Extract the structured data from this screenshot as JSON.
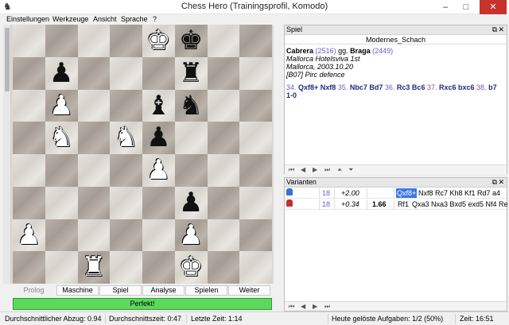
{
  "window": {
    "title": "Chess Hero (Trainingsprofil, Komodo)",
    "minimize": "–",
    "maximize": "□",
    "close": "✕"
  },
  "menu": [
    "Einstellungen",
    "Werkzeuge",
    "Ansicht",
    "Sprache",
    "?"
  ],
  "board": {
    "rows": [
      [
        "",
        "",
        "",
        "",
        "wK",
        "bK",
        "",
        ""
      ],
      [
        "",
        "bP",
        "",
        "",
        "",
        "bR",
        "",
        ""
      ],
      [
        "",
        "wP",
        "",
        "",
        "bB",
        "bN",
        "",
        ""
      ],
      [
        "",
        "wN",
        "",
        "wN",
        "bP",
        "",
        "",
        ""
      ],
      [
        "",
        "",
        "",
        "",
        "wP",
        "",
        "",
        ""
      ],
      [
        "",
        "",
        "",
        "",
        "",
        "bP",
        "",
        ""
      ],
      [
        "wP",
        "",
        "",
        "",
        "",
        "wP",
        "",
        ""
      ],
      [
        "",
        "",
        "wR",
        "",
        "",
        "wK",
        "",
        ""
      ]
    ],
    "glyphs": {
      "K": "♚",
      "Q": "♛",
      "R": "♜",
      "B": "♝",
      "N": "♞",
      "P": "♟"
    }
  },
  "tabs": [
    "Prolog",
    "Maschine",
    "Spiel",
    "Analyse",
    "Spielen",
    "Weiter"
  ],
  "feedback": "Perfekt!",
  "game_panel": {
    "title": "Spiel",
    "name": "Modernes_Schach",
    "white": "Cabrera",
    "white_elo": "(2516)",
    "vs": "gg.",
    "black": "Braga",
    "black_elo": "(2449)",
    "event": "Mallorca Hotelsviva 1st",
    "place_date": "Mallorca, 2003.10.20",
    "eco": "[B07] Pirc defence",
    "moves": [
      {
        "num": "34.",
        "text": "Qxf8+ Nxf8"
      },
      {
        "num": "35.",
        "text": "Nbc7 Bd7"
      },
      {
        "num": "36.",
        "text": "Rc3 Bc6"
      },
      {
        "num": "37.",
        "text": "Rxc6 bxc6"
      },
      {
        "num": "38.",
        "text": "b7"
      }
    ],
    "result": "1-0"
  },
  "variants_panel": {
    "title": "Varianten",
    "rows": [
      {
        "depth": "18",
        "eval": "+2.00",
        "extra": "",
        "first": "Qxf8+",
        "line": "Nxf8 Rc7 Kh8 Kf1 Rd7 a4"
      },
      {
        "depth": "18",
        "eval": "+0.34",
        "extra": "1.66",
        "first": "Rf1",
        "line": "Qxa3 Nxa3 Bxd5 exd5 Nf4 Re"
      }
    ]
  },
  "status": {
    "avg_dev": "Durchschnittlicher Abzug: 0.94",
    "avg_time": "Durchschnittszeit: 0:47",
    "last_time": "Letzte Zeit: 1:14",
    "solved": "Heute gelöste Aufgaben: 1/2 (50%)",
    "time": "Zeit: 16:51"
  },
  "colors": {
    "accent": "#3b78e7",
    "success": "#5cd85c",
    "close": "#c8322d"
  }
}
